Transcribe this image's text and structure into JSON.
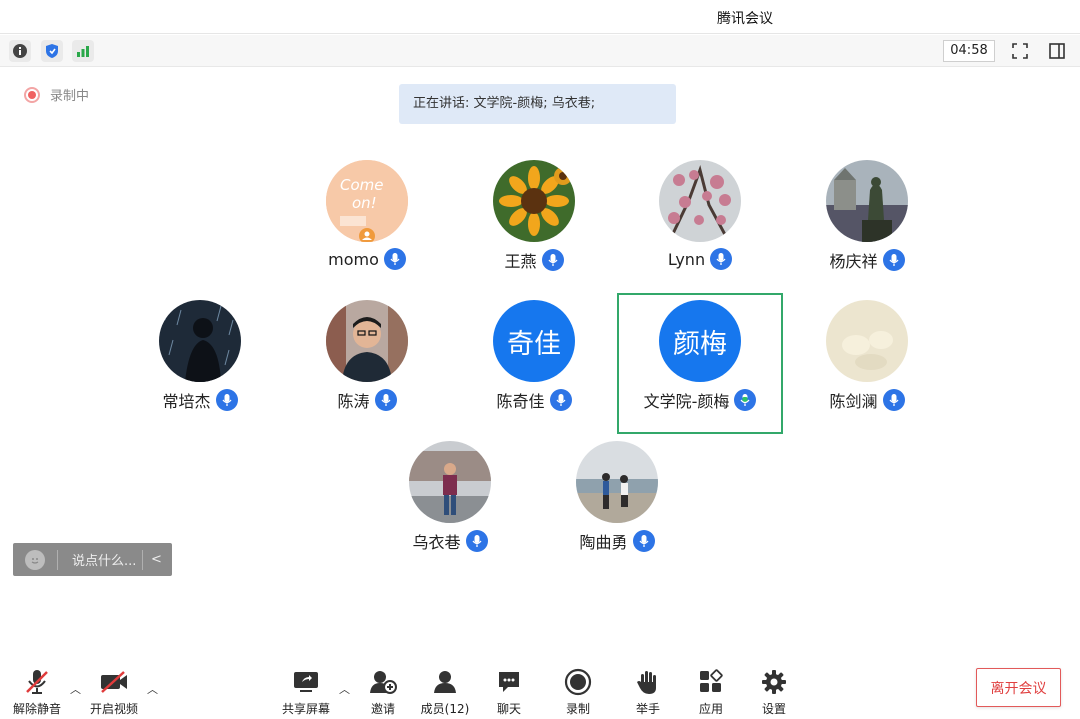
{
  "window": {
    "title": "腾讯会议"
  },
  "statusbar": {
    "icons": [
      "info-icon",
      "shield-icon",
      "signal-icon"
    ],
    "timer": "04:58",
    "right_icons": [
      "fullscreen-icon",
      "sidebar-layout-icon"
    ]
  },
  "recording": {
    "label": "录制中"
  },
  "speaking": {
    "text": "正在讲话: 文学院-颜梅; 乌衣巷;"
  },
  "participants": [
    {
      "name": "momo",
      "avatar": "come-on-image",
      "mic": "mic-icon"
    },
    {
      "name": "王燕",
      "avatar": "sunflower-image",
      "mic": "mic-icon"
    },
    {
      "name": "Lynn",
      "avatar": "magnolia-image",
      "mic": "mic-icon"
    },
    {
      "name": "杨庆祥",
      "avatar": "statue-image",
      "mic": "mic-icon"
    },
    {
      "name": "常培杰",
      "avatar": "person-rain-image",
      "mic": "mic-icon"
    },
    {
      "name": "陈涛",
      "avatar": "man-portrait-image",
      "mic": "mic-icon"
    },
    {
      "name": "陈奇佳",
      "avatar_text": "奇佳",
      "mic": "mic-icon"
    },
    {
      "name": "文学院-颜梅",
      "avatar_text": "颜梅",
      "mic": "mic-active-icon",
      "active": true
    },
    {
      "name": "陈剑澜",
      "avatar": "cream-image",
      "mic": "mic-icon"
    },
    {
      "name": "乌衣巷",
      "avatar": "man-street-image",
      "mic": "mic-icon"
    },
    {
      "name": "陶曲勇",
      "avatar": "beach-image",
      "mic": "mic-icon"
    }
  ],
  "chat": {
    "placeholder": "说点什么...",
    "collapse": "<"
  },
  "toolbar": {
    "unmute": "解除静音",
    "start_video": "开启视频",
    "share_screen": "共享屏幕",
    "invite": "邀请",
    "members": "成员(12)",
    "chat": "聊天",
    "record": "录制",
    "raise_hand": "举手",
    "apps": "应用",
    "settings": "设置",
    "leave": "离开会议"
  },
  "colors": {
    "accent": "#2d74e6",
    "active_border": "#32a86a",
    "leave": "#e04040",
    "banner": "#dfe9f7"
  }
}
